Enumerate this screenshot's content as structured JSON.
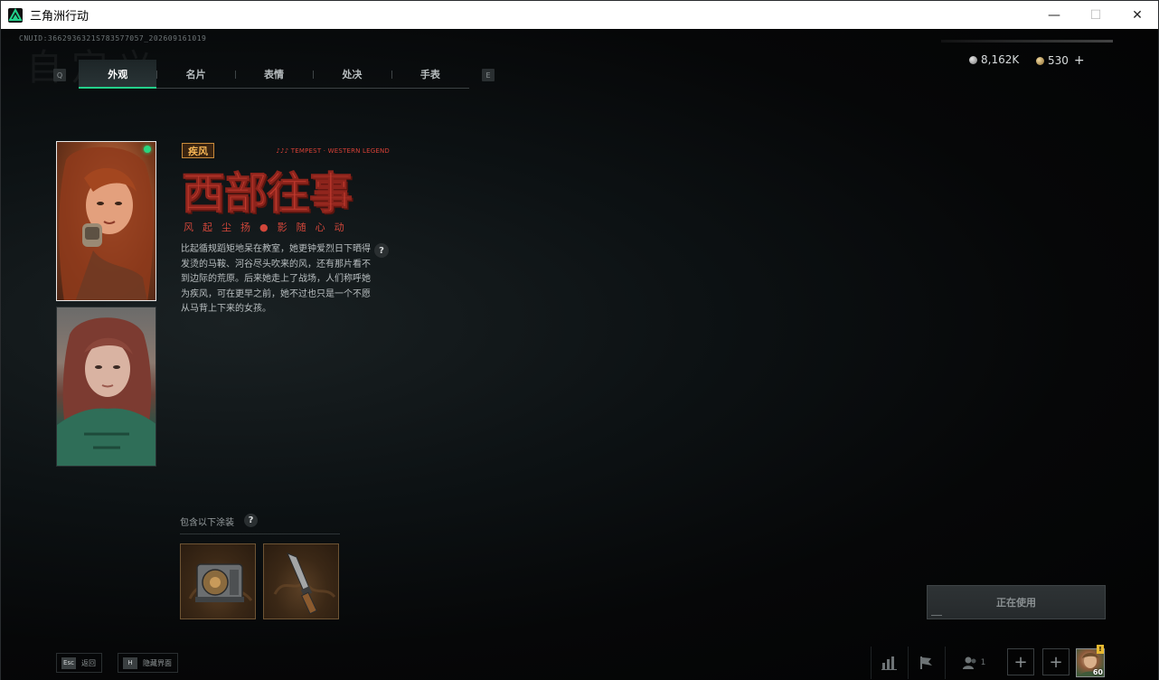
{
  "window": {
    "title": "三角洲行动",
    "minimize": "—",
    "maximize": "☐",
    "close": "✕"
  },
  "uid": "CNUID:3662936321S783577057_202609161019",
  "ghost_title": "自定义",
  "tab_keys": {
    "prev": "Q",
    "next": "E"
  },
  "tabs": [
    {
      "label": "外观",
      "active": true
    },
    {
      "label": "名片",
      "active": false
    },
    {
      "label": "表情",
      "active": false
    },
    {
      "label": "处决",
      "active": false
    },
    {
      "label": "手表",
      "active": false
    }
  ],
  "currency": {
    "silver": "8,162K",
    "gold": "530",
    "add": "+"
  },
  "skin": {
    "tag": "疾风",
    "english_title": "♪♪♪ TEMPEST · WESTERN LEGEND",
    "title": "西部往事",
    "subtitle": "风起尘扬●影随心动",
    "description": "比起循规蹈矩地呆在教室，她更钟爱烈日下晒得发烫的马鞍、河谷尽头吹来的风，还有那片看不到边际的荒原。后来她走上了战场，人们称呼她为疾风，可在更早之前，她不过也只是一个不愿从马背上下来的女孩。",
    "help": "?"
  },
  "includes": {
    "label": "包含以下涂装",
    "help": "?"
  },
  "in_use_button": "正在使用",
  "hints": [
    {
      "key": "Esc",
      "text": "返回"
    },
    {
      "key": "H",
      "text": "隐藏界面"
    }
  ],
  "bottom_bar": {
    "friends_count": "1",
    "add": "+",
    "player_level": "60",
    "badge": "!"
  },
  "colors": {
    "accent": "#23d08a",
    "title_red": "#c33b2f",
    "tag_gold": "#f3b354"
  }
}
